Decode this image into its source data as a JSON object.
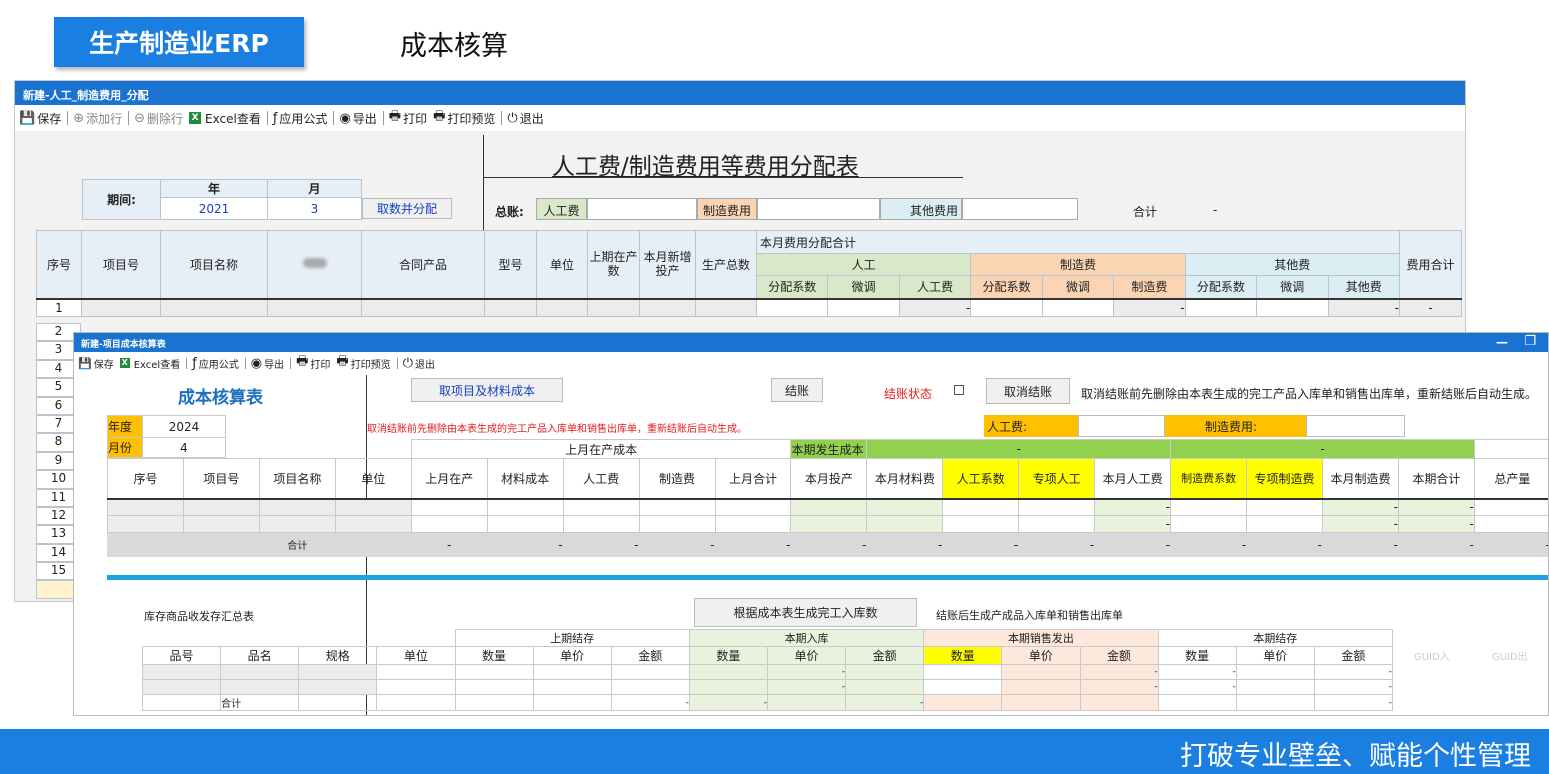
{
  "banner": {
    "title": "生产制造业ERP",
    "module": "成本核算"
  },
  "footer": {
    "slogan": "打破专业壁垒、赋能个性管理"
  },
  "win1": {
    "title": "新建-人工_制造费用_分配",
    "toolbar": [
      "保存",
      "添加行",
      "删除行",
      "Excel查看",
      "应用公式",
      "导出",
      "打印",
      "打印预览",
      "退出"
    ],
    "form_title": "人工费/制造费用等费用分配表",
    "period_label": "期间:",
    "year_label": "年",
    "month_label": "月",
    "year": "2021",
    "month": "3",
    "fetch_button": "取数并分配",
    "total_label": "总账:",
    "labor_label": "人工费",
    "mfg_label": "制造费用",
    "other_label": "其他费用",
    "sum_label": "合计",
    "sum_value": "-",
    "headers": {
      "seq": "序号",
      "item_no": "项目号",
      "item_name": "项目名称",
      "contract": "合同产品",
      "model": "型号",
      "unit": "单位",
      "prev_wip": "上期在产数",
      "new_input": "本月新增投产",
      "total_prod": "生产总数",
      "alloc_total": "本月费用分配合计",
      "labor": "人工",
      "mfg": "制造费",
      "other": "其他费",
      "fee_total": "费用合计",
      "coef": "分配系数",
      "adjust": "微调",
      "labor_fee": "人工费",
      "mfg_fee": "制造费",
      "other_fee": "其他费"
    },
    "rows": [
      "1",
      "2",
      "3",
      "4",
      "5",
      "6",
      "7",
      "8",
      "9",
      "10",
      "11",
      "12",
      "13",
      "14",
      "15"
    ],
    "dash": "-"
  },
  "win2": {
    "title": "新建-项目成本核算表",
    "toolbar": [
      "保存",
      "Excel查看",
      "应用公式",
      "导出",
      "打印",
      "打印预览",
      "退出"
    ],
    "sheet_title": "成本核算表",
    "btn_fetch": "取项目及材料成本",
    "btn_close": "结账",
    "close_state_label": "结账状态",
    "btn_cancel": "取消结账",
    "notice": "取消结账前先删除由本表生成的完工产品入库单和销售出库单，重新结账后自动生成。",
    "year_label": "年度",
    "year": "2024",
    "month_label": "月份",
    "month": "4",
    "labor_label": "人工费:",
    "mfg_label": "制造费用:",
    "prev_cost": "上月在产成本",
    "cur_cost": "本期发生成本",
    "cols": [
      "序号",
      "项目号",
      "项目名称",
      "单位",
      "上月在产",
      "材料成本",
      "人工费",
      "制造费",
      "上月合计",
      "本月投产",
      "本月材料费",
      "人工系数",
      "专项人工",
      "本月人工费",
      "制造费系数",
      "专项制造费",
      "本月制造费",
      "本期合计",
      "总产量"
    ],
    "sum_label": "合计",
    "dash": "-",
    "inv_title": "库存商品收发存汇总表",
    "btn_gen": "根据成本表生成完工入库数",
    "gen_note": "结账后生成产成品入库单和销售出库单",
    "inv_groups": [
      "上期结存",
      "本期入库",
      "本期销售发出",
      "本期结存"
    ],
    "inv_cols": [
      "品号",
      "品名",
      "规格",
      "单位",
      "数量",
      "单价",
      "金额",
      "数量",
      "单价",
      "金额",
      "数量",
      "单价",
      "金额",
      "数量",
      "单价",
      "金额",
      "GUID入",
      "GUID出"
    ]
  }
}
